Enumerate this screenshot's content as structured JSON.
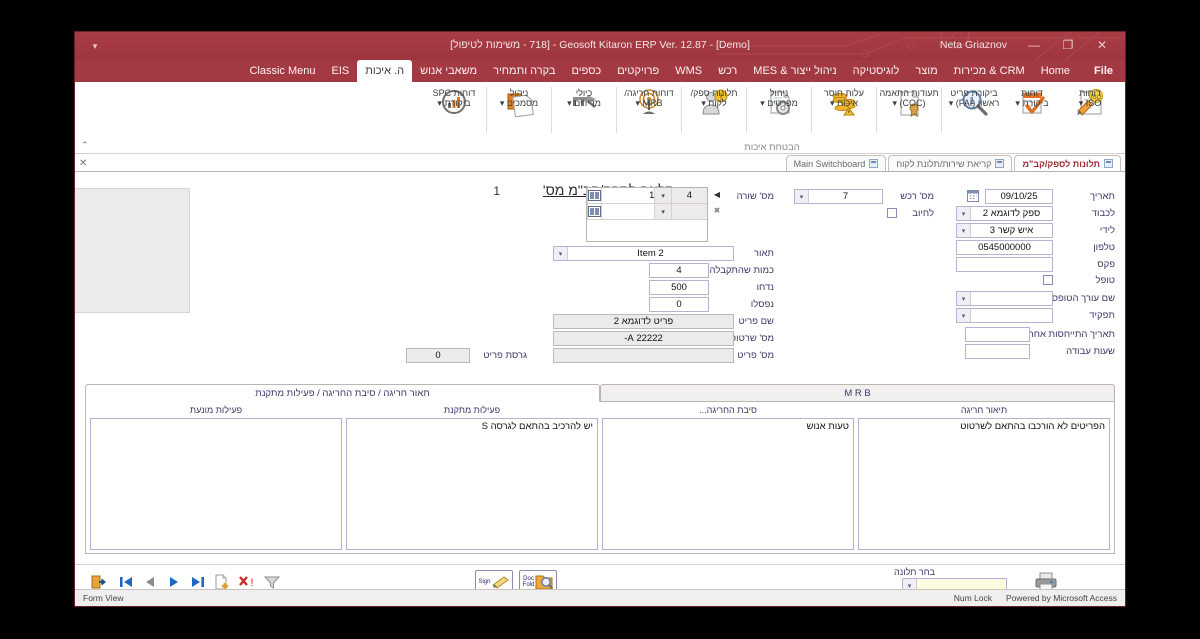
{
  "titlebar": {
    "qat_icon": "customize-quick-access-icon",
    "title": "Geosoft Kitaron ERP Ver. 12.87 - [Demo] - [718 - משימות לטיפול]",
    "user": "Neta Griaznov",
    "minimize": "—",
    "restore": "❐",
    "close": "✕"
  },
  "ribbon_tabs": [
    {
      "label": "File",
      "active": false
    },
    {
      "label": "Home",
      "active": false
    },
    {
      "label": "CRM & מכירות",
      "active": false
    },
    {
      "label": "מוצר",
      "active": false
    },
    {
      "label": "לוגיסטיקה",
      "active": false
    },
    {
      "label": "ניהול ייצור & MES",
      "active": false
    },
    {
      "label": "רכש",
      "active": false
    },
    {
      "label": "WMS",
      "active": false
    },
    {
      "label": "פרויקטים",
      "active": false
    },
    {
      "label": "כספים",
      "active": false
    },
    {
      "label": "בקרה ותמחיר",
      "active": false
    },
    {
      "label": "משאבי אנוש",
      "active": false
    },
    {
      "label": "ה. איכות",
      "active": true
    },
    {
      "label": "EIS",
      "active": false
    },
    {
      "label": "Classic Menu",
      "active": false
    }
  ],
  "ribbon": {
    "group_label": "הבטחת איכות",
    "collapse_icon": "chevron-up-icon",
    "buttons": [
      {
        "label": "דוחות\nISO ▾",
        "icon": "iso-report-icon"
      },
      {
        "label": "דוחות\nביקורת ▾",
        "icon": "audit-report-icon"
      },
      {
        "label": "ביקורת פריט\nראשון (FAI) ▾",
        "icon": "first-article-inspection-icon"
      },
      {
        "label": "תעודות התאמה\n(COC) ▾",
        "icon": "certificate-of-conformance-icon"
      },
      {
        "label": "עלות חוסר\nאיכות ▾",
        "icon": "cost-of-poor-quality-icon"
      },
      {
        "label": "ניהול\nמפרטים ▾",
        "icon": "specification-management-icon"
      },
      {
        "label": "תלונות ספק/\nלקוח ▾",
        "icon": "supplier-customer-complaints-icon"
      },
      {
        "label": "דוחות חריגה/\nMRB ▾",
        "icon": "deviation-mrb-icon"
      },
      {
        "label": "כיולי\nמדידים ▾",
        "icon": "gauge-calibration-icon"
      },
      {
        "label": "ניהול\nמסמכים ▾",
        "icon": "document-management-icon"
      },
      {
        "label": "דוחות SPC\nביקורת ▾",
        "icon": "spc-reports-icon"
      }
    ]
  },
  "doc_tabs": [
    {
      "label": "Main Switchboard",
      "active": false
    },
    {
      "label": "קריאת שירות/תלונת לקוח",
      "active": false
    },
    {
      "label": "תלונות לספק/קב\"מ",
      "active": true
    }
  ],
  "doc_tabs_close": "✕",
  "form": {
    "title": "תלונה לספק/קב\"מ מס'",
    "number": "1",
    "image_placeholder": "form-image-placeholder",
    "right_column": [
      {
        "label": "תאריך",
        "value": "09/10/25",
        "type": "date",
        "icon": "calendar-icon"
      },
      {
        "label": "לכבוד",
        "value": "ספק לדוגמא 2",
        "type": "combo"
      },
      {
        "label": "לידי",
        "value": "איש קשר 3",
        "type": "combo"
      },
      {
        "label": "טלפון",
        "value": "0545000000",
        "type": "text"
      },
      {
        "label": "פקס",
        "value": "",
        "type": "text"
      },
      {
        "label": "טופל",
        "value": "",
        "type": "checkbox"
      },
      {
        "label": "שם עורך הטופס",
        "value": "",
        "type": "combo"
      },
      {
        "label": "תפקיד",
        "value": "",
        "type": "combo"
      },
      {
        "label": "תאריך התייחסות אחרון",
        "value": "",
        "type": "text"
      },
      {
        "label": "שעות עבודה",
        "value": "",
        "type": "text"
      }
    ],
    "mid_column": {
      "asset_label": "מס' רכש",
      "asset_value": "7",
      "charge_label": "לחיוב",
      "row_label": "מס' שורה",
      "grid": {
        "row1": {
          "num": "4",
          "txt": "1",
          "book_icon": "record-book-icon"
        },
        "row2": {
          "num": "",
          "txt": "",
          "book_icon": "record-book-icon"
        }
      },
      "fields": [
        {
          "label": "תאור",
          "value": "Item 2",
          "type": "combo"
        },
        {
          "label": "כמות שהתקבלה",
          "value": "4",
          "type": "text"
        },
        {
          "label": "נדחו",
          "value": "500",
          "type": "text"
        },
        {
          "label": "נפסלו",
          "value": "0",
          "type": "text"
        },
        {
          "label": "שם פריט",
          "value": "פריט לדוגמא 2",
          "type": "readonly"
        },
        {
          "label": "מס' שרטוט",
          "value": "22222 A-",
          "type": "readonly"
        },
        {
          "label": "מס' פריט",
          "value": "",
          "type": "readonly"
        }
      ],
      "version_label": "גרסת פריט",
      "version_value": "0"
    },
    "lower_tabs": [
      {
        "label": "תאור חריגה / סיבת החריגה / פעילות מתקנת",
        "active": true
      },
      {
        "label": "M R B",
        "active": false
      }
    ],
    "lower_columns": [
      {
        "header": "תיאור חריגה",
        "value": "הפריטים לא הורכבו בהתאם לשרטוט"
      },
      {
        "header": "סיבת החריגה...",
        "value": "טעות אנוש"
      },
      {
        "header": "פעילות מתקנת",
        "value": "יש להרכיב בהתאם לגרסה S"
      },
      {
        "header": "פעילות מונעת",
        "value": ""
      }
    ]
  },
  "navbar": {
    "buttons": [
      {
        "icon": "exit-door-icon",
        "name": "exit-button"
      },
      {
        "icon": "first-record-icon",
        "name": "first-record-button"
      },
      {
        "icon": "previous-record-icon",
        "name": "previous-record-button"
      },
      {
        "icon": "next-record-icon",
        "name": "next-record-button"
      },
      {
        "icon": "last-record-icon",
        "name": "last-record-button"
      },
      {
        "icon": "new-record-icon",
        "name": "new-record-button"
      },
      {
        "icon": "delete-record-icon",
        "name": "delete-record-button"
      },
      {
        "icon": "filter-icon",
        "name": "filter-button"
      }
    ],
    "sign_button": {
      "line1": "Sign",
      "icon": "signature-icon"
    },
    "docfold_button": {
      "line1": "Doc",
      "line2": "Fold",
      "icon": "document-folder-search-icon"
    },
    "select_complaint_label": "בחר תלונה",
    "select_complaint_value": "",
    "print_icon": "printer-icon"
  },
  "statusbar": {
    "view": "Form View",
    "numlock": "Num Lock",
    "powered": "Powered by Microsoft Access"
  },
  "colors": {
    "brand_red": "#a33942",
    "label_blue": "#3b3769",
    "field_border": "#b6b2cf",
    "readonly_bg": "#eceaea"
  }
}
